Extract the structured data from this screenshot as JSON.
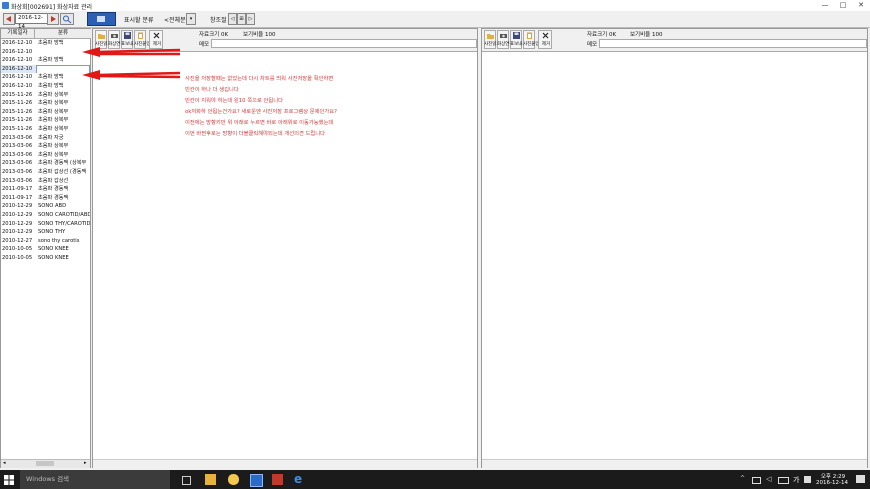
{
  "window": {
    "title": "화상회[002691] 화상자료 관리",
    "controls": [
      "—",
      "□",
      "✕"
    ]
  },
  "toolbar": {
    "date_value": "2016-12-14",
    "display_label": "표시할 분류",
    "category_value": "<전체분류>",
    "zoom_label": "창조절",
    "zoom_buttons": [
      "◁",
      "⊞",
      "▷"
    ]
  },
  "list": {
    "headers": [
      "기록일자",
      "분류"
    ],
    "rows": [
      {
        "date": "2016-12-10",
        "category": "초음파 방백"
      },
      {
        "date": "2016-12-10",
        "category": ""
      },
      {
        "date": "2016-12-10",
        "category": "초음파 방백"
      },
      {
        "date": "2016-12-10",
        "category": "",
        "selected": true
      },
      {
        "date": "2016-12-10",
        "category": "초음파 방백"
      },
      {
        "date": "2016-12-10",
        "category": "초음파 방백"
      },
      {
        "date": "2015-11-26",
        "category": "초음파 상복부"
      },
      {
        "date": "2015-11-26",
        "category": "초음파 상복부"
      },
      {
        "date": "2015-11-26",
        "category": "초음파 상복부"
      },
      {
        "date": "2015-11-26",
        "category": "초음파 상복부"
      },
      {
        "date": "2015-11-26",
        "category": "초음파 상복부"
      },
      {
        "date": "2013-03-06",
        "category": "초음파 자궁"
      },
      {
        "date": "2013-03-06",
        "category": "초음파 상복부"
      },
      {
        "date": "2013-03-06",
        "category": "초음파 상복부"
      },
      {
        "date": "2013-03-06",
        "category": "초음파 경동맥 (상복부"
      },
      {
        "date": "2013-03-06",
        "category": "초음파 갑상선 (경동맥"
      },
      {
        "date": "2013-03-06",
        "category": "초음파 갑상선"
      },
      {
        "date": "2011-09-17",
        "category": "초음파 경동맥"
      },
      {
        "date": "2011-09-17",
        "category": "초음파 경동맥"
      },
      {
        "date": "2010-12-29",
        "category": "SONO ABD"
      },
      {
        "date": "2010-12-29",
        "category": "SONO CAROTID/ABD"
      },
      {
        "date": "2010-12-29",
        "category": "SONO THY/CAROTID"
      },
      {
        "date": "2010-12-29",
        "category": "SONO THY"
      },
      {
        "date": "2010-12-27",
        "category": "sono thy carotis"
      },
      {
        "date": "2010-10-05",
        "category": "SONO KNEE"
      },
      {
        "date": "2010-10-05",
        "category": "SONO KNEE"
      }
    ]
  },
  "panel": {
    "buttons": [
      "사진읽기",
      "화상연결",
      "표보내기",
      "사진붙임",
      "제거"
    ],
    "file_size_label": "자료크기 0K",
    "view_ratio_label": "보기비율 100",
    "memo_label": "메모"
  },
  "notes": [
    "사진을 저장할때는 없었는데 다시 차트를 띄워 사진저장을 확인하면",
    "빈칸이 하나 더 생깁니다",
    "빈칸이 지워야 하는데 왼10 쪽으로 안됩니다",
    "ok저화하 안됩는건가요? 새로운엔 사진저장 프로그램상 문제인가요?",
    "이전에는 방향키만 위 아래로 누르면 바로 아래위로 이동가능했는데",
    "이번 바뀐후로는 방향이 더블클릭해야되는데 개선의견 드립니다"
  ],
  "taskbar": {
    "search_placeholder": "Windows 검색",
    "ime": "가",
    "time": "오후 2:29",
    "date": "2016-12-14"
  },
  "colors": {
    "annotation_red": "#d23a3a",
    "arrow_red": "#e01818",
    "taskbar": "#1b1b1b"
  }
}
